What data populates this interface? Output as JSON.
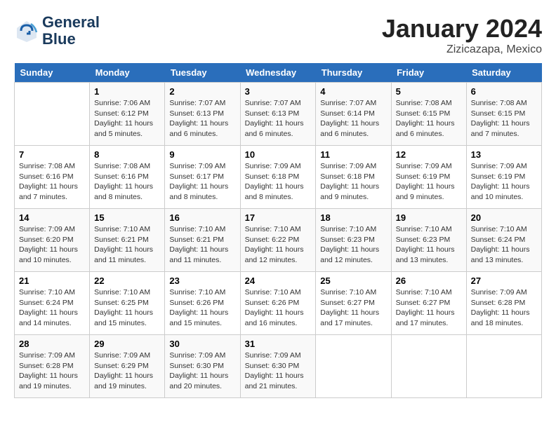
{
  "header": {
    "logo_line1": "General",
    "logo_line2": "Blue",
    "month_year": "January 2024",
    "location": "Zizicazapa, Mexico"
  },
  "weekdays": [
    "Sunday",
    "Monday",
    "Tuesday",
    "Wednesday",
    "Thursday",
    "Friday",
    "Saturday"
  ],
  "weeks": [
    [
      {
        "day": "",
        "info": ""
      },
      {
        "day": "1",
        "info": "Sunrise: 7:06 AM\nSunset: 6:12 PM\nDaylight: 11 hours\nand 5 minutes."
      },
      {
        "day": "2",
        "info": "Sunrise: 7:07 AM\nSunset: 6:13 PM\nDaylight: 11 hours\nand 6 minutes."
      },
      {
        "day": "3",
        "info": "Sunrise: 7:07 AM\nSunset: 6:13 PM\nDaylight: 11 hours\nand 6 minutes."
      },
      {
        "day": "4",
        "info": "Sunrise: 7:07 AM\nSunset: 6:14 PM\nDaylight: 11 hours\nand 6 minutes."
      },
      {
        "day": "5",
        "info": "Sunrise: 7:08 AM\nSunset: 6:15 PM\nDaylight: 11 hours\nand 6 minutes."
      },
      {
        "day": "6",
        "info": "Sunrise: 7:08 AM\nSunset: 6:15 PM\nDaylight: 11 hours\nand 7 minutes."
      }
    ],
    [
      {
        "day": "7",
        "info": "Sunrise: 7:08 AM\nSunset: 6:16 PM\nDaylight: 11 hours\nand 7 minutes."
      },
      {
        "day": "8",
        "info": "Sunrise: 7:08 AM\nSunset: 6:16 PM\nDaylight: 11 hours\nand 8 minutes."
      },
      {
        "day": "9",
        "info": "Sunrise: 7:09 AM\nSunset: 6:17 PM\nDaylight: 11 hours\nand 8 minutes."
      },
      {
        "day": "10",
        "info": "Sunrise: 7:09 AM\nSunset: 6:18 PM\nDaylight: 11 hours\nand 8 minutes."
      },
      {
        "day": "11",
        "info": "Sunrise: 7:09 AM\nSunset: 6:18 PM\nDaylight: 11 hours\nand 9 minutes."
      },
      {
        "day": "12",
        "info": "Sunrise: 7:09 AM\nSunset: 6:19 PM\nDaylight: 11 hours\nand 9 minutes."
      },
      {
        "day": "13",
        "info": "Sunrise: 7:09 AM\nSunset: 6:19 PM\nDaylight: 11 hours\nand 10 minutes."
      }
    ],
    [
      {
        "day": "14",
        "info": "Sunrise: 7:09 AM\nSunset: 6:20 PM\nDaylight: 11 hours\nand 10 minutes."
      },
      {
        "day": "15",
        "info": "Sunrise: 7:10 AM\nSunset: 6:21 PM\nDaylight: 11 hours\nand 11 minutes."
      },
      {
        "day": "16",
        "info": "Sunrise: 7:10 AM\nSunset: 6:21 PM\nDaylight: 11 hours\nand 11 minutes."
      },
      {
        "day": "17",
        "info": "Sunrise: 7:10 AM\nSunset: 6:22 PM\nDaylight: 11 hours\nand 12 minutes."
      },
      {
        "day": "18",
        "info": "Sunrise: 7:10 AM\nSunset: 6:23 PM\nDaylight: 11 hours\nand 12 minutes."
      },
      {
        "day": "19",
        "info": "Sunrise: 7:10 AM\nSunset: 6:23 PM\nDaylight: 11 hours\nand 13 minutes."
      },
      {
        "day": "20",
        "info": "Sunrise: 7:10 AM\nSunset: 6:24 PM\nDaylight: 11 hours\nand 13 minutes."
      }
    ],
    [
      {
        "day": "21",
        "info": "Sunrise: 7:10 AM\nSunset: 6:24 PM\nDaylight: 11 hours\nand 14 minutes."
      },
      {
        "day": "22",
        "info": "Sunrise: 7:10 AM\nSunset: 6:25 PM\nDaylight: 11 hours\nand 15 minutes."
      },
      {
        "day": "23",
        "info": "Sunrise: 7:10 AM\nSunset: 6:26 PM\nDaylight: 11 hours\nand 15 minutes."
      },
      {
        "day": "24",
        "info": "Sunrise: 7:10 AM\nSunset: 6:26 PM\nDaylight: 11 hours\nand 16 minutes."
      },
      {
        "day": "25",
        "info": "Sunrise: 7:10 AM\nSunset: 6:27 PM\nDaylight: 11 hours\nand 17 minutes."
      },
      {
        "day": "26",
        "info": "Sunrise: 7:10 AM\nSunset: 6:27 PM\nDaylight: 11 hours\nand 17 minutes."
      },
      {
        "day": "27",
        "info": "Sunrise: 7:09 AM\nSunset: 6:28 PM\nDaylight: 11 hours\nand 18 minutes."
      }
    ],
    [
      {
        "day": "28",
        "info": "Sunrise: 7:09 AM\nSunset: 6:28 PM\nDaylight: 11 hours\nand 19 minutes."
      },
      {
        "day": "29",
        "info": "Sunrise: 7:09 AM\nSunset: 6:29 PM\nDaylight: 11 hours\nand 19 minutes."
      },
      {
        "day": "30",
        "info": "Sunrise: 7:09 AM\nSunset: 6:30 PM\nDaylight: 11 hours\nand 20 minutes."
      },
      {
        "day": "31",
        "info": "Sunrise: 7:09 AM\nSunset: 6:30 PM\nDaylight: 11 hours\nand 21 minutes."
      },
      {
        "day": "",
        "info": ""
      },
      {
        "day": "",
        "info": ""
      },
      {
        "day": "",
        "info": ""
      }
    ]
  ]
}
